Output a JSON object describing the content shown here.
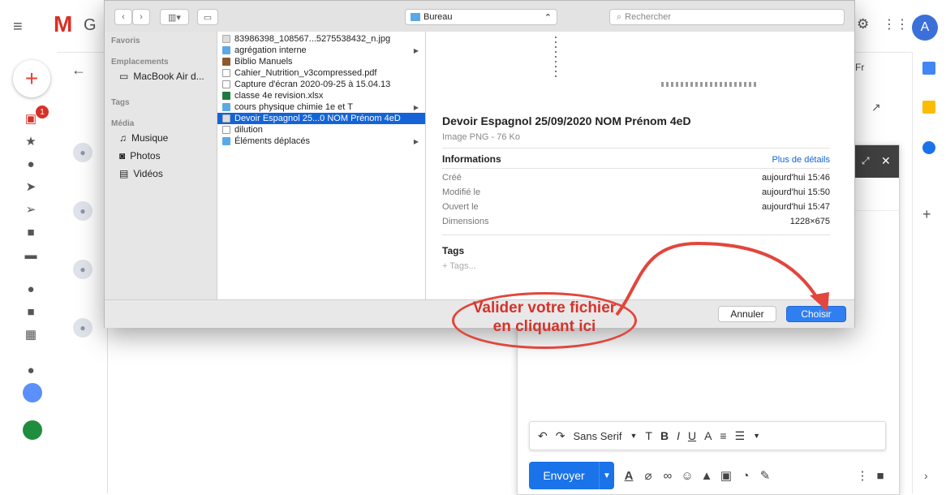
{
  "gmail": {
    "logo_letter": "G",
    "avatar_initial": "A",
    "lang_button": "Fr",
    "inbox_badge": "1",
    "icons": [
      "menu-icon",
      "mail-logo-icon",
      "settings-icon",
      "apps-icon",
      "back-icon",
      "compose-plus-icon",
      "inbox-icon",
      "star-icon",
      "clock-icon",
      "label-icon",
      "send-icon",
      "draft-icon",
      "tag-icon",
      "chat-icon",
      "video-icon",
      "keyboard-icon",
      "hangouts-icon"
    ]
  },
  "dialog": {
    "location": "Bureau",
    "search_placeholder": "Rechercher",
    "sidebar": {
      "favorites_header": "Favoris",
      "locations_header": "Emplacements",
      "locations": [
        "MacBook Air d..."
      ],
      "tags_header": "Tags",
      "media_header": "Média",
      "media": [
        "Musique",
        "Photos",
        "Vidéos"
      ]
    },
    "files": [
      {
        "name": "83986398_108567...5275538432_n.jpg",
        "kind": "img",
        "arrow": false
      },
      {
        "name": "agrégation interne",
        "kind": "folder",
        "arrow": true
      },
      {
        "name": "Biblio Manuels",
        "kind": "app",
        "arrow": false
      },
      {
        "name": "Cahier_Nutrition_v3compressed.pdf",
        "kind": "doc",
        "arrow": false
      },
      {
        "name": "Capture d'écran 2020-09-25 à 15.04.13",
        "kind": "doc",
        "arrow": false
      },
      {
        "name": "classe 4e revision.xlsx",
        "kind": "xls",
        "arrow": false
      },
      {
        "name": "cours physique chimie 1e et T",
        "kind": "folder",
        "arrow": true
      },
      {
        "name": "Devoir Espagnol  25...0 NOM Prénom 4eD",
        "kind": "img",
        "arrow": false,
        "selected": true
      },
      {
        "name": "dilution",
        "kind": "doc",
        "arrow": false
      },
      {
        "name": "Éléments déplacés",
        "kind": "folder",
        "arrow": true
      }
    ],
    "preview": {
      "title": "Devoir Espagnol  25/09/2020 NOM Prénom 4eD",
      "subtitle": "Image PNG - 76 Ko",
      "info_header": "Informations",
      "more_details": "Plus de détails",
      "rows": [
        {
          "label": "Créé",
          "value": "aujourd'hui 15:46"
        },
        {
          "label": "Modifié le",
          "value": "aujourd'hui 15:50"
        },
        {
          "label": "Ouvert le",
          "value": "aujourd'hui 15:47"
        },
        {
          "label": "Dimensions",
          "value": "1228×675"
        }
      ],
      "tags_header": "Tags",
      "tags_placeholder": "+ Tags..."
    },
    "cancel_label": "Annuler",
    "choose_label": "Choisir"
  },
  "annotation": {
    "line1": "Valider votre fichier",
    "line2": "en cliquant ici",
    "color": "#e2463c"
  },
  "compose": {
    "font_name": "Sans Serif",
    "send_label": "Envoyer"
  }
}
